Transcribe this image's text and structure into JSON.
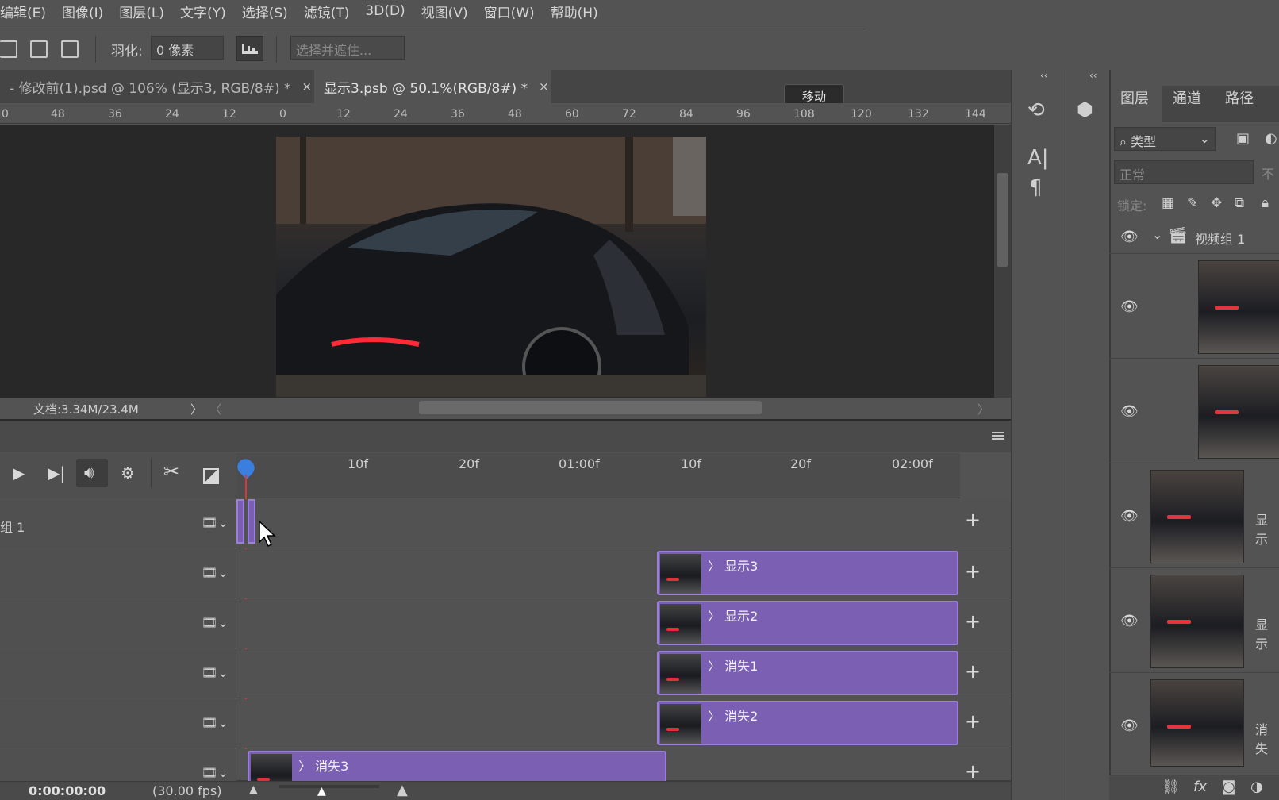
{
  "menu": [
    "编辑(E)",
    "图像(I)",
    "图层(L)",
    "文字(Y)",
    "选择(S)",
    "滤镜(T)",
    "3D(D)",
    "视图(V)",
    "窗口(W)",
    "帮助(H)"
  ],
  "options": {
    "feather_label": "羽化:",
    "feather_value": "0 像素",
    "select_mask": "选择并遮住..."
  },
  "tabs": [
    {
      "label": "- 修改前(1).psd @ 106% (显示3, RGB/8#) *",
      "close": "×"
    },
    {
      "label": "显示3.psb @ 50.1%(RGB/8#) *",
      "close": "×"
    }
  ],
  "tooltip": "移动",
  "ruler": [
    "0",
    "48",
    "36",
    "24",
    "12",
    "0",
    "12",
    "24",
    "36",
    "48",
    "60",
    "72",
    "84",
    "96",
    "108",
    "120",
    "132",
    "144"
  ],
  "status": {
    "doc": "文档:3.34M/23.4M",
    "arrow": "〉",
    "left": "〈",
    "right": "〉"
  },
  "timeline": {
    "scale": [
      "10f",
      "20f",
      "01:00f",
      "10f",
      "20f",
      "02:00f"
    ],
    "group_label": "组 1",
    "timecode": "0:00:00:00",
    "fps": "(30.00 fps)",
    "clips": [
      {
        "name": "显示3"
      },
      {
        "name": "显示2"
      },
      {
        "name": "消失1"
      },
      {
        "name": "消失2"
      },
      {
        "name": "消失3"
      }
    ],
    "plus": "+",
    "chev": "〉"
  },
  "layers_panel": {
    "tabs": [
      "图层",
      "通道",
      "路径"
    ],
    "filter": "类型",
    "blend": "正常",
    "opacity_label": "不",
    "lock_label": "锁定:",
    "group": "视频组 1",
    "layer_names": [
      "显示",
      "显示",
      "消失"
    ]
  },
  "icons": [
    "search-icon",
    "play-icon",
    "step-forward-icon",
    "audio-icon",
    "gear-icon",
    "scissors-icon",
    "transition-icon",
    "eye-icon",
    "film-icon",
    "plus-icon",
    "link-icon",
    "fx-icon",
    "mask-icon",
    "adjustment-icon"
  ]
}
